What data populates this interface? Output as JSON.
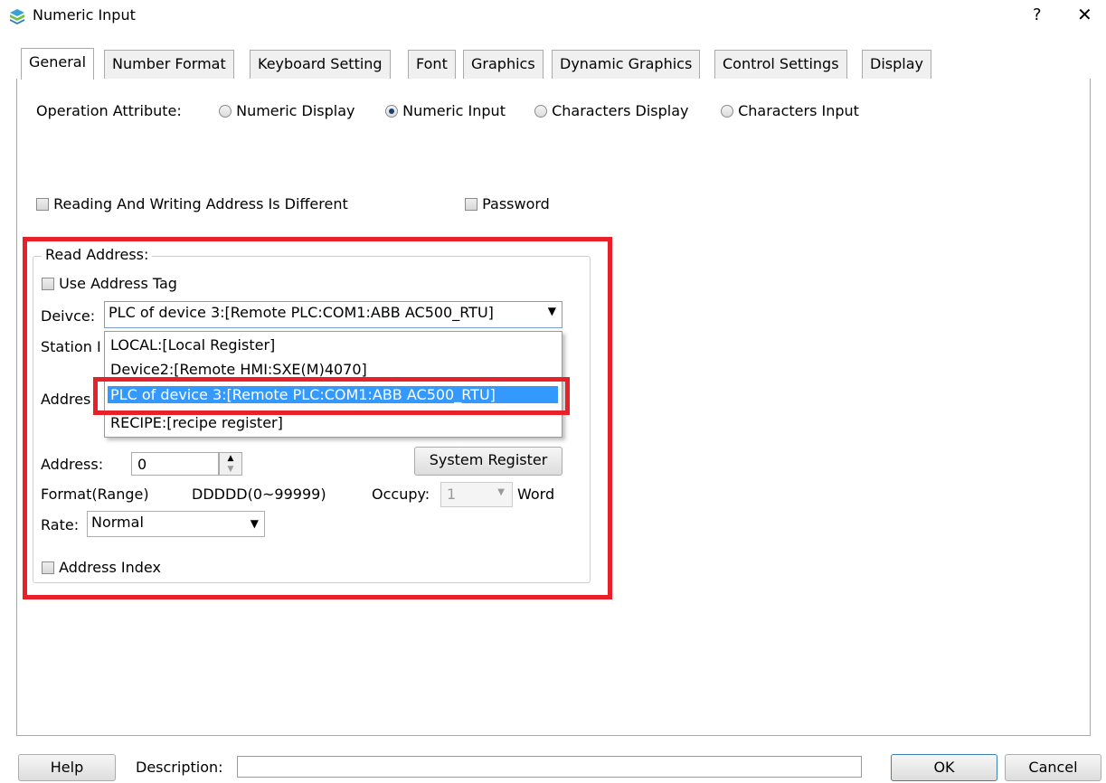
{
  "window": {
    "title": "Numeric Input",
    "help_glyph": "?",
    "close_glyph": "✕"
  },
  "tabs": [
    {
      "label": "General"
    },
    {
      "label": "Number Format"
    },
    {
      "label": "Keyboard Setting"
    },
    {
      "label": "Font"
    },
    {
      "label": "Graphics"
    },
    {
      "label": "Dynamic Graphics"
    },
    {
      "label": "Control Settings"
    },
    {
      "label": "Display"
    }
  ],
  "operation": {
    "label": "Operation Attribute:",
    "options": [
      "Numeric Display",
      "Numeric Input",
      "Characters Display",
      "Characters Input"
    ],
    "selected": "Numeric Input"
  },
  "checks": {
    "rw_different": "Reading And Writing Address Is Different",
    "password": "Password"
  },
  "read_address": {
    "title": "Read Address:",
    "use_tag": "Use Address Tag",
    "device_label": "Deivce:",
    "device_value": "PLC of device 3:[Remote PLC:COM1:ABB AC500_RTU]",
    "station_label": "Station I",
    "address_type_label": "Addres",
    "device_options": [
      "LOCAL:[Local Register]",
      "Device2:[Remote HMI:SXE(M)4070]",
      "PLC of device 3:[Remote PLC:COM1:ABB AC500_RTU]",
      "RECIPE:[recipe register]"
    ],
    "address_label": "Address:",
    "address_value": "0",
    "system_register": "System Register",
    "format_label": "Format(Range)",
    "format_value": "DDDDD(0~99999)",
    "occupy_label": "Occupy:",
    "occupy_value": "1",
    "occupy_unit": "Word",
    "rate_label": "Rate:",
    "rate_value": "Normal",
    "address_index": "Address Index"
  },
  "footer": {
    "help": "Help",
    "description_label": "Description:",
    "description_value": "",
    "ok": "OK",
    "cancel": "Cancel"
  },
  "colors": {
    "highlight_red": "#e8202a",
    "selection_blue": "#3399ff"
  }
}
